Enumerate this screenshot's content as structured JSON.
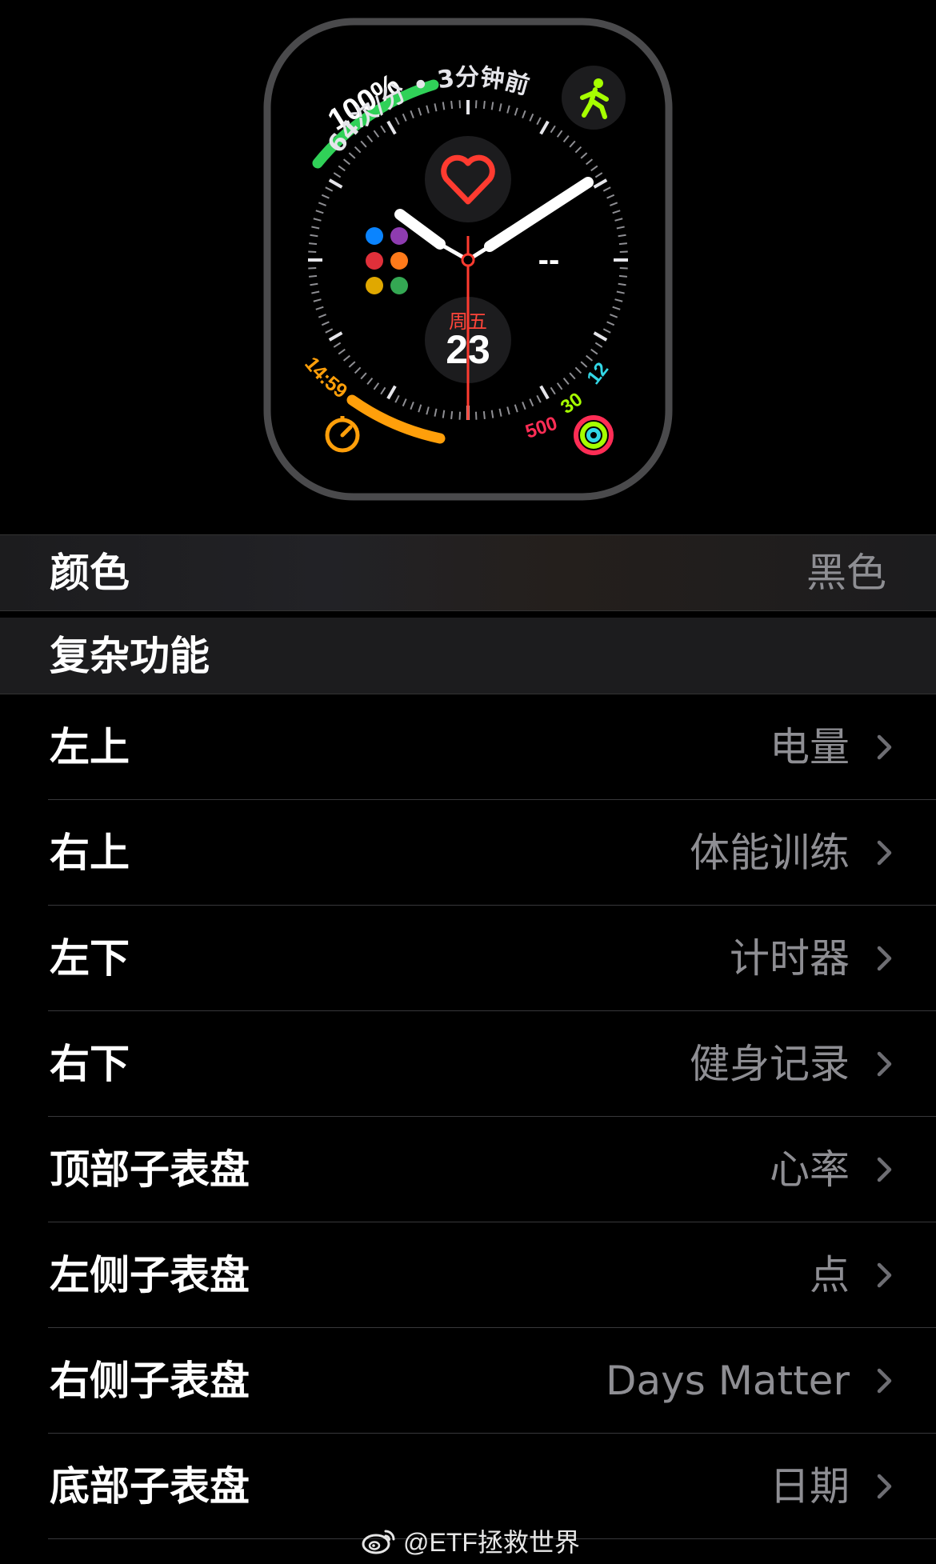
{
  "watch_face": {
    "top_left_gauge": "100%",
    "heart_rate_text": "64次/分 • 3分钟前",
    "top_right_icon": "workout-runner-icon",
    "subdial_right_value": "--",
    "date_weekday": "周五",
    "date_day": "23",
    "timer_value": "14:59",
    "activity_move": "500",
    "activity_exercise": "30",
    "activity_stand": "12",
    "colors": {
      "battery": "#30d158",
      "timer": "#ff9f0a",
      "move": "#ff2d55",
      "exercise": "#a6ff00",
      "stand": "#32d7e6",
      "seconds_hand": "#ff3b30"
    }
  },
  "color_row": {
    "label": "颜色",
    "value": "黑色"
  },
  "complications_header": "复杂功能",
  "complications": [
    {
      "label": "左上",
      "value": "电量"
    },
    {
      "label": "右上",
      "value": "体能训练"
    },
    {
      "label": "左下",
      "value": "计时器"
    },
    {
      "label": "右下",
      "value": "健身记录"
    },
    {
      "label": "顶部子表盘",
      "value": "心率"
    },
    {
      "label": "左侧子表盘",
      "value": "点"
    },
    {
      "label": "右侧子表盘",
      "value": "Days Matter"
    },
    {
      "label": "底部子表盘",
      "value": "日期"
    }
  ],
  "watermark": "@ETF拯救世界"
}
